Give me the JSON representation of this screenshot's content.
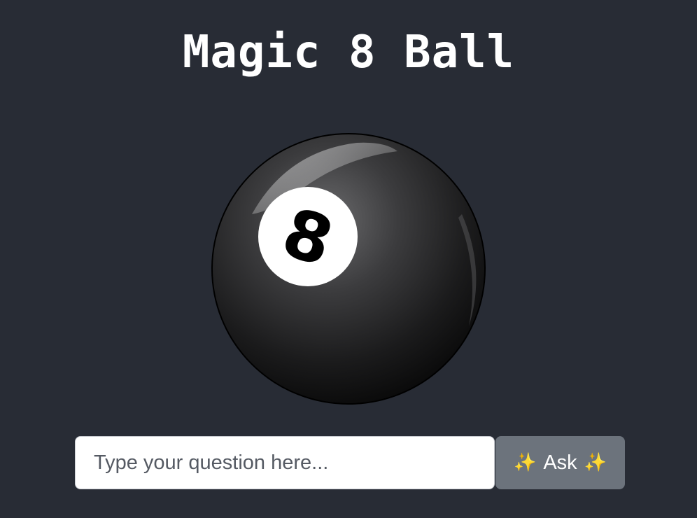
{
  "app": {
    "title": "Magic 8 Ball"
  },
  "ball": {
    "number": "8",
    "icon": "eight-ball-icon"
  },
  "ask_form": {
    "input_placeholder": "Type your question here...",
    "input_value": "",
    "button_label": "Ask",
    "button_sparkle_icon": "sparkles-icon",
    "sparkle_glyph": "✨"
  },
  "colors": {
    "background": "#282c35",
    "button": "#6c737c",
    "title": "#ffffff"
  }
}
